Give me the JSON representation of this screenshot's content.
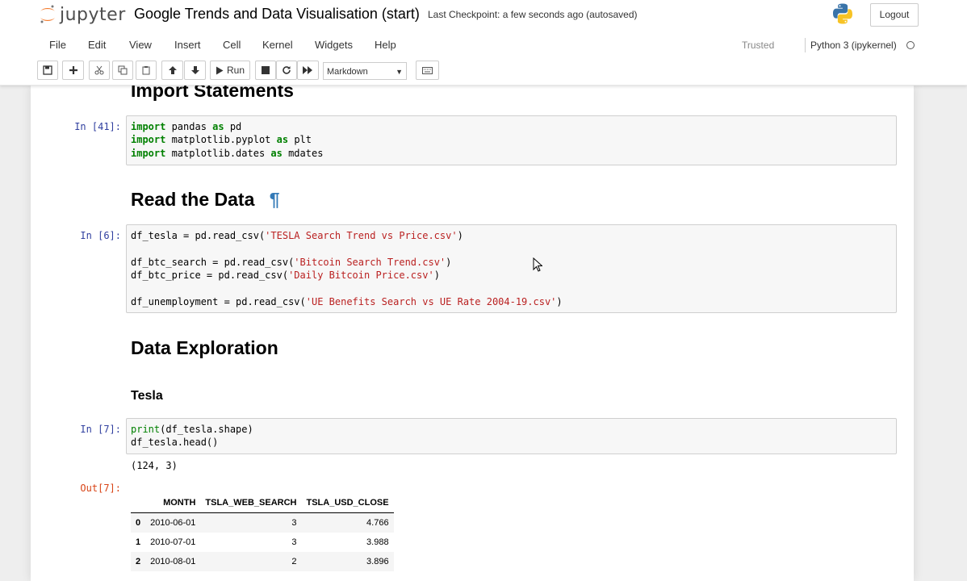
{
  "header": {
    "logo_text": "jupyter",
    "notebook_title": "Google Trends and Data Visualisation (start)",
    "checkpoint": "Last Checkpoint:  a few seconds ago   (autosaved)",
    "logout_label": "Logout"
  },
  "menu": {
    "items": [
      "File",
      "Edit",
      "View",
      "Insert",
      "Cell",
      "Kernel",
      "Widgets",
      "Help"
    ],
    "trusted": "Trusted",
    "kernel_name": "Python 3 (ipykernel)"
  },
  "toolbar": {
    "run_label": "Run",
    "cell_type": "Markdown"
  },
  "cells": {
    "import_heading": "Import Statements",
    "import_prompt": "In [41]:",
    "import_lines": [
      {
        "kw": "import",
        "rest1": " pandas ",
        "kw2": "as",
        "rest2": " pd"
      },
      {
        "kw": "import",
        "rest1": " matplotlib.pyplot ",
        "kw2": "as",
        "rest2": " plt"
      },
      {
        "kw": "import",
        "rest1": " matplotlib.dates ",
        "kw2": "as",
        "rest2": " mdates"
      }
    ],
    "read_heading": "Read the Data",
    "anchor_symbol": "¶",
    "read_prompt": "In [6]:",
    "read_lines": [
      {
        "var": "df_tesla = pd.read_csv(",
        "str": "'TESLA Search Trend vs Price.csv'",
        "end": ")"
      },
      {
        "var": "df_btc_search = pd.read_csv(",
        "str": "'Bitcoin Search Trend.csv'",
        "end": ")"
      },
      {
        "var": "df_btc_price = pd.read_csv(",
        "str": "'Daily Bitcoin Price.csv'",
        "end": ")"
      },
      {
        "var": "df_unemployment = pd.read_csv(",
        "str": "'UE Benefits Search vs UE Rate 2004-19.csv'",
        "end": ")"
      }
    ],
    "explore_heading": "Data Exploration",
    "tesla_heading": "Tesla",
    "tesla_prompt": "In [7]:",
    "tesla_line1_fn": "print",
    "tesla_line1_rest": "(df_tesla.shape)",
    "tesla_line2": "df_tesla.head()",
    "shape_output": "(124, 3)",
    "out_prompt": "Out[7]:",
    "table": {
      "columns": [
        "",
        "MONTH",
        "TSLA_WEB_SEARCH",
        "TSLA_USD_CLOSE"
      ],
      "rows": [
        [
          "0",
          "2010-06-01",
          "3",
          "4.766"
        ],
        [
          "1",
          "2010-07-01",
          "3",
          "3.988"
        ],
        [
          "2",
          "2010-08-01",
          "2",
          "3.896"
        ]
      ]
    }
  }
}
